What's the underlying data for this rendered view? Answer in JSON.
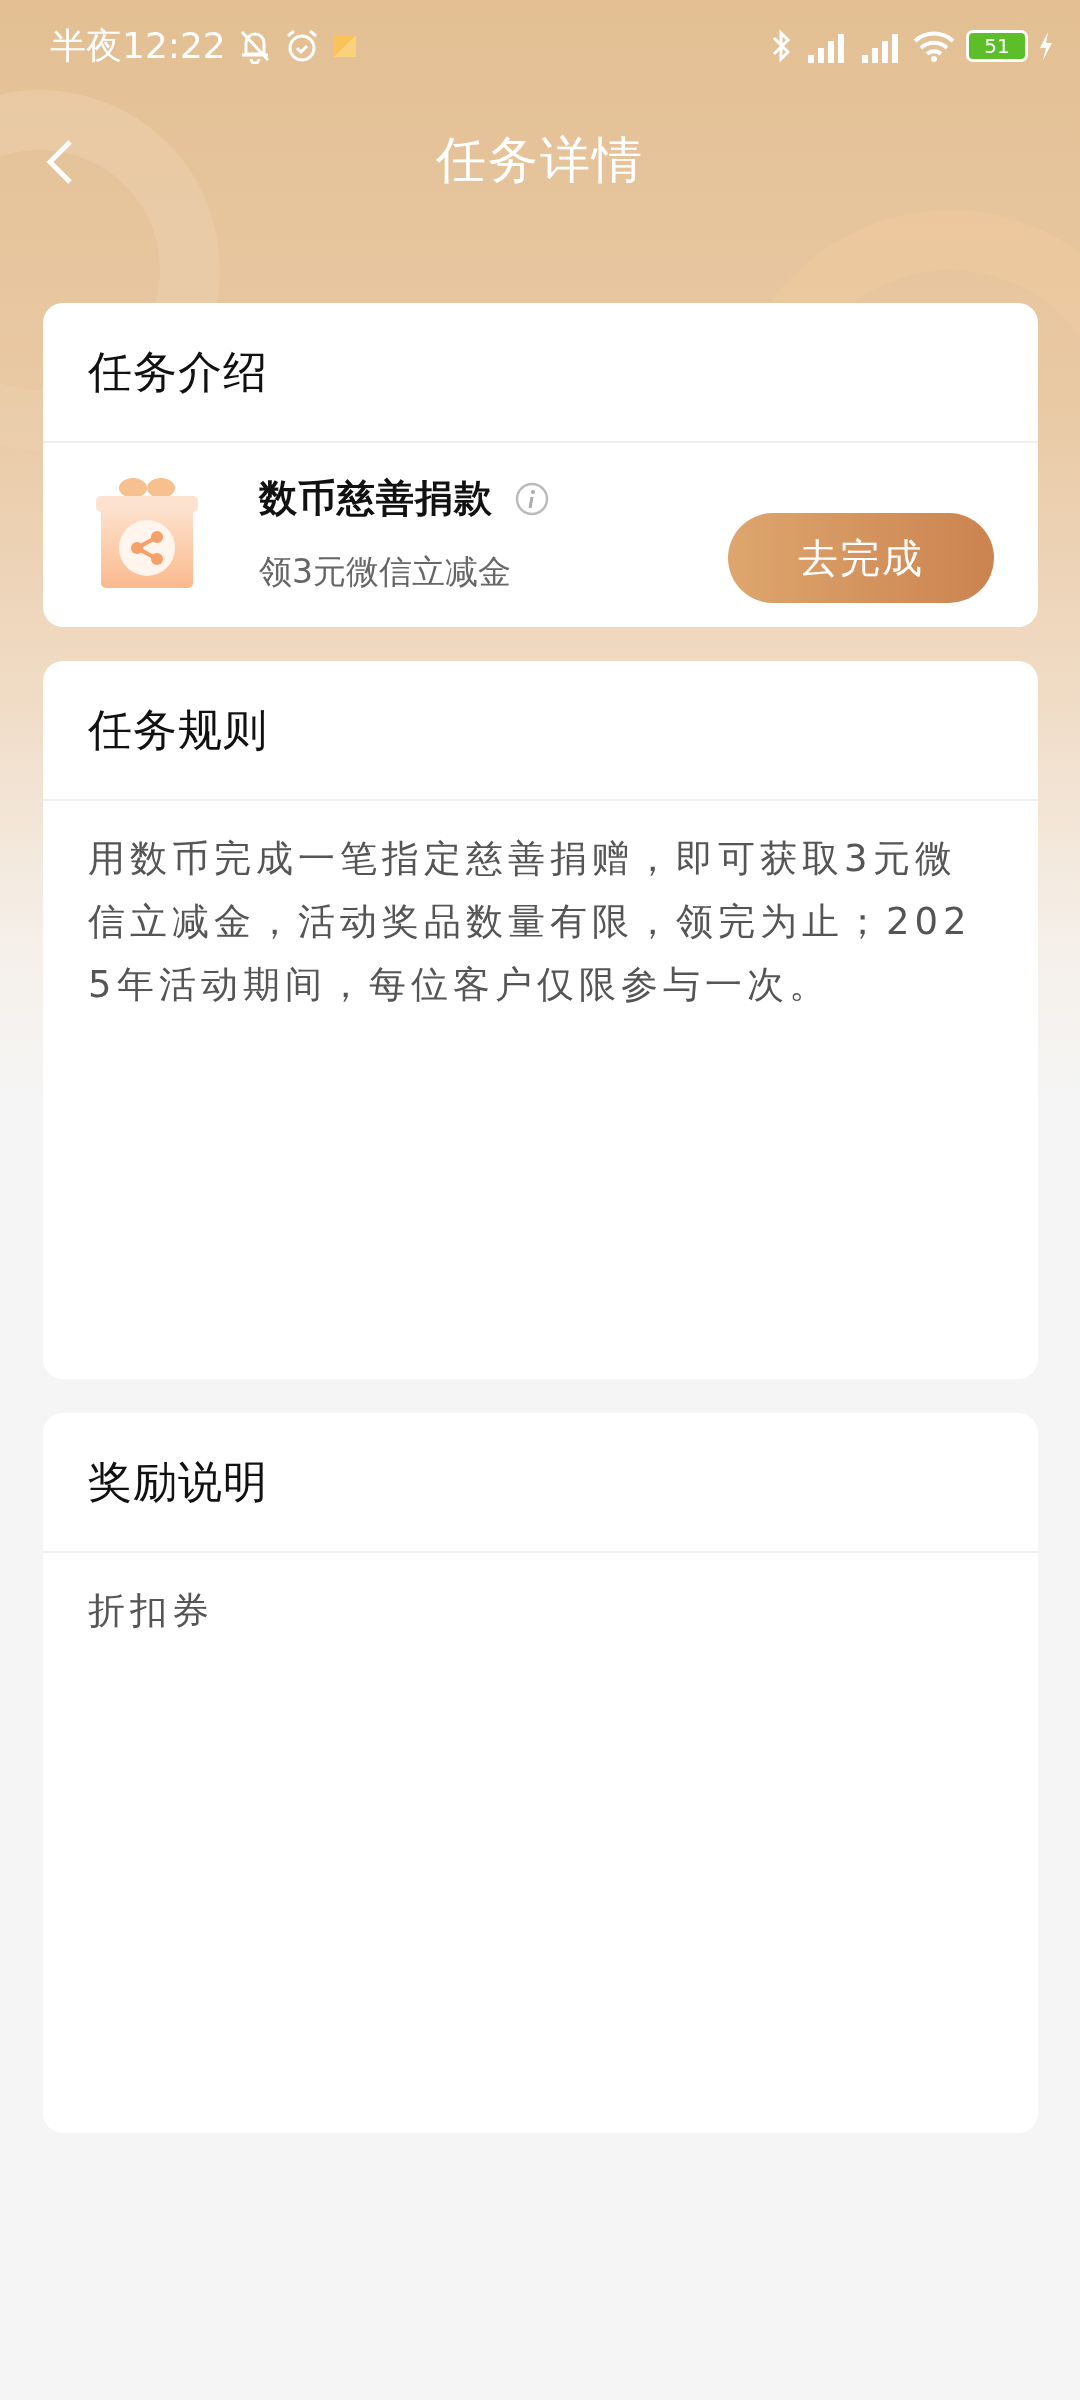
{
  "status_bar": {
    "time": "半夜12:22",
    "battery": "51"
  },
  "header": {
    "title": "任务详情"
  },
  "intro": {
    "heading": "任务介绍",
    "task": {
      "name": "数币慈善捐款",
      "reward": "领3元微信立减金",
      "action": "去完成"
    }
  },
  "rules": {
    "heading": "任务规则",
    "text": "用数币完成一笔指定慈善捐赠，即可获取3元微信立减金，活动奖品数量有限，领完为止；2025年活动期间，每位客户仅限参与一次。"
  },
  "reward": {
    "heading": "奖励说明",
    "text": "折扣券"
  }
}
